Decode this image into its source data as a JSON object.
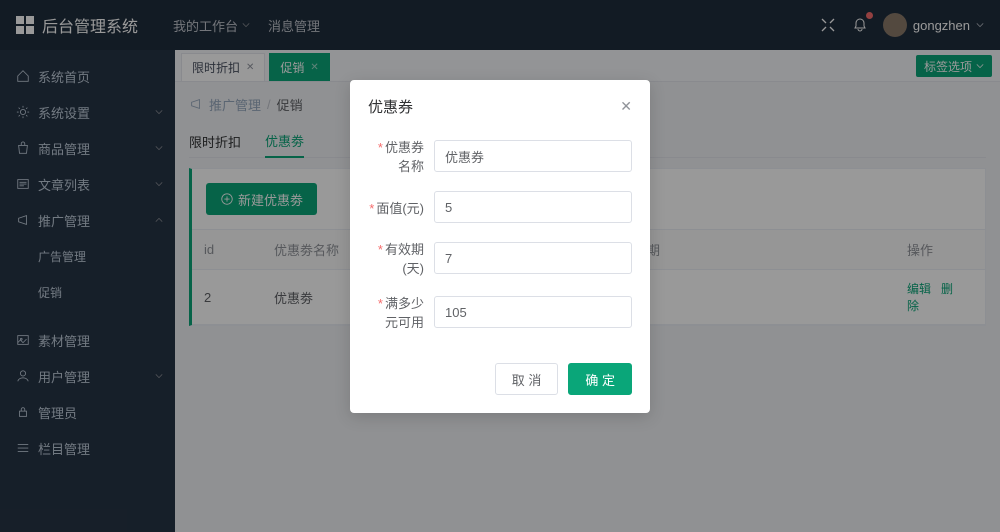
{
  "header": {
    "title": "后台管理系统",
    "workbench": "我的工作台",
    "messages": "消息管理",
    "username": "gongzhen"
  },
  "sidebar": {
    "items": [
      {
        "label": "系统首页"
      },
      {
        "label": "系统设置"
      },
      {
        "label": "商品管理"
      },
      {
        "label": "文章列表"
      },
      {
        "label": "推广管理"
      },
      {
        "label": "广告管理"
      },
      {
        "label": "促销"
      },
      {
        "label": "素材管理"
      },
      {
        "label": "用户管理"
      },
      {
        "label": "管理员"
      },
      {
        "label": "栏目管理"
      }
    ]
  },
  "tabs": {
    "t0": "限时折扣",
    "t1": "促销",
    "opts": "标签选项"
  },
  "breadcrumb": {
    "b1": "推广管理",
    "sep": "/",
    "b2": "促销"
  },
  "pageTabs": {
    "p0": "限时折扣",
    "p1": "优惠劵"
  },
  "toolbar": {
    "create": "新建优惠劵"
  },
  "table": {
    "headers": {
      "id": "id",
      "name": "优惠劵名称",
      "expire": "效期",
      "action": "操作"
    },
    "row": {
      "id": "2",
      "name": "优惠劵",
      "edit": "编辑",
      "del": "删除"
    }
  },
  "dialog": {
    "title": "优惠券",
    "fields": {
      "name_label": "优惠券名称",
      "name_value": "优惠券",
      "face_label": "面值(元)",
      "face_value": "5",
      "valid_label": "有效期(天)",
      "valid_value": "7",
      "min_label": "满多少元可用",
      "min_value": "105"
    },
    "cancel": "取 消",
    "confirm": "确 定"
  }
}
